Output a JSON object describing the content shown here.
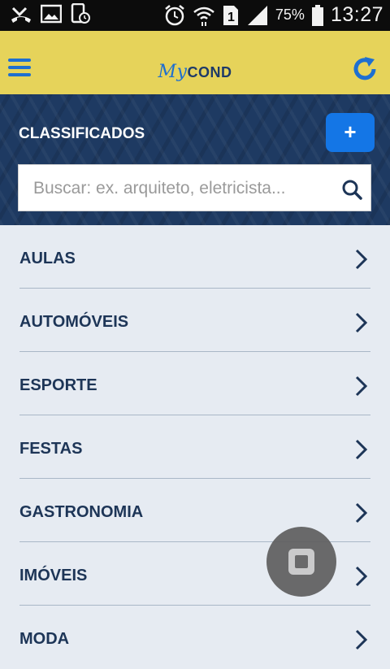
{
  "status_bar": {
    "battery_percent": "75%",
    "time": "13:27",
    "sim_slot": "1",
    "icons": [
      "missed-call-icon",
      "image-icon",
      "phone-sync-icon",
      "alarm-icon",
      "wifi-icon",
      "sim-icon",
      "signal-icon",
      "battery-icon"
    ]
  },
  "app_bar": {
    "logo_my": "My",
    "logo_cond": "COND",
    "accent_color": "#1e6fd0",
    "background_color": "#e6d35a"
  },
  "section": {
    "title": "CLASSIFICADOS",
    "add_label": "+",
    "search_placeholder": "Buscar: ex. arquiteto, eletricista..."
  },
  "categories": [
    {
      "label": "AULAS"
    },
    {
      "label": "AUTOMÓVEIS"
    },
    {
      "label": "ESPORTE"
    },
    {
      "label": "FESTAS"
    },
    {
      "label": "GASTRONOMIA"
    },
    {
      "label": "IMÓVEIS"
    },
    {
      "label": "MODA"
    }
  ]
}
